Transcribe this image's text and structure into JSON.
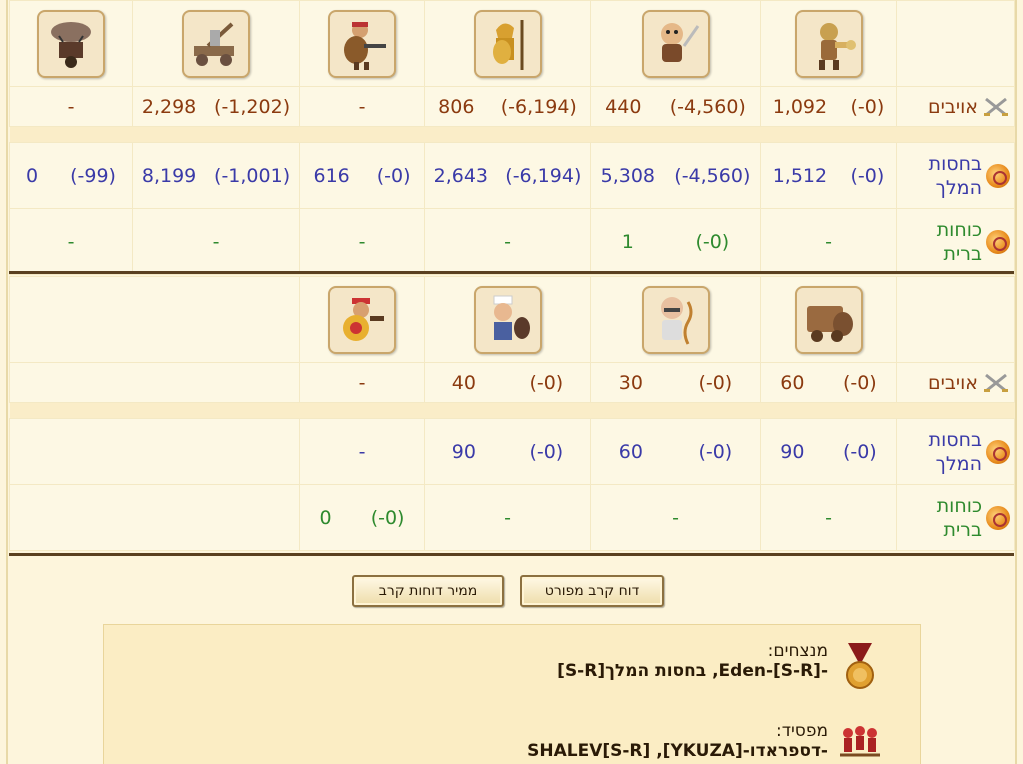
{
  "labels": {
    "enemies": "אויבים",
    "royal_guard_l1": "בחסות",
    "royal_guard_l2": "המלך",
    "allies_l1": "כוחות",
    "allies_l2": "ברית"
  },
  "table1": {
    "units": [
      "warrior-horn-unit",
      "dagger-thief-unit",
      "spartan-spear-unit",
      "shield-gunner-unit",
      "siege-catapult-unit",
      "war-airship-unit"
    ],
    "enemies": [
      {
        "count": "1,092",
        "loss": "(-0)"
      },
      {
        "count": "440",
        "loss": "(-4,560)"
      },
      {
        "count": "806",
        "loss": "(-6,194)"
      },
      {
        "dash": "-"
      },
      {
        "count": "2,298",
        "loss": "(-1,202)"
      },
      {
        "dash": "-"
      }
    ],
    "guard": [
      {
        "count": "1,512",
        "loss": "(-0)"
      },
      {
        "count": "5,308",
        "loss": "(-4,560)"
      },
      {
        "count": "2,643",
        "loss": "(-6,194)"
      },
      {
        "count": "616",
        "loss": "(-0)"
      },
      {
        "count": "8,199",
        "loss": "(-1,001)"
      },
      {
        "count": "0",
        "loss": "(-99)"
      }
    ],
    "allies": [
      {
        "dash": "-"
      },
      {
        "count": "1",
        "loss": "(-0)"
      },
      {
        "dash": "-"
      },
      {
        "dash": "-"
      },
      {
        "dash": "-"
      },
      {
        "dash": "-"
      }
    ]
  },
  "table2": {
    "units": [
      "cannon-wagon-unit",
      "elder-healer-unit",
      "chef-cook-unit",
      "pirate-shield-unit"
    ],
    "enemies": [
      {
        "count": "60",
        "loss": "(-0)"
      },
      {
        "count": "30",
        "loss": "(-0)"
      },
      {
        "count": "40",
        "loss": "(-0)"
      },
      {
        "dash": "-"
      }
    ],
    "guard": [
      {
        "count": "90",
        "loss": "(-0)"
      },
      {
        "count": "60",
        "loss": "(-0)"
      },
      {
        "count": "90",
        "loss": "(-0)"
      },
      {
        "dash": "-"
      }
    ],
    "allies": [
      {
        "dash": "-"
      },
      {
        "dash": "-"
      },
      {
        "dash": "-"
      },
      {
        "count": "0",
        "loss": "(-0)"
      }
    ]
  },
  "buttons": {
    "detailed_report": "דוח קרב מפורט",
    "report_archive": "ממיר דוחות קרב"
  },
  "result": {
    "winners_title": "מנצחים:",
    "winners_value": "-[S-R]-Eden, בחסות המלך[S-R]",
    "loser_title": "מפסיד:",
    "loser_value": "-דספראדו-[YKUZA], SHALEV[S-R]"
  },
  "colors": {
    "enemy": "#8b3a0f",
    "guard": "#3a3aa8",
    "ally": "#2e8a2e",
    "background": "#fdf5dc"
  }
}
